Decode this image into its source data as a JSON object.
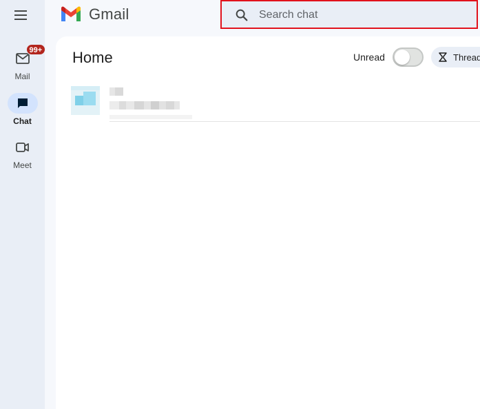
{
  "app": {
    "name": "Gmail",
    "logo_icon": "gmail-m-logo"
  },
  "header": {
    "menu_icon": "hamburger-menu-icon",
    "search": {
      "placeholder": "Search chat",
      "value": ""
    }
  },
  "nav": {
    "items": [
      {
        "key": "mail",
        "label": "Mail",
        "icon": "mail-icon",
        "badge": "99+",
        "active": false
      },
      {
        "key": "chat",
        "label": "Chat",
        "icon": "chat-icon",
        "active": true
      },
      {
        "key": "meet",
        "label": "Meet",
        "icon": "video-camera-icon",
        "active": false
      }
    ]
  },
  "main": {
    "title": "Home",
    "unread_filter": {
      "label": "Unread",
      "enabled": false
    },
    "threads_chip": {
      "label": "Threads",
      "icon": "threads-icon"
    },
    "conversations": [
      {
        "avatar_icon": "blurred-avatar",
        "name": "",
        "preview": "",
        "blurred": true
      }
    ]
  },
  "colors": {
    "accent": "#d3e3fd",
    "badge": "#b3261e",
    "highlight_border": "#e1111b",
    "rail_bg": "#e9eef6"
  }
}
